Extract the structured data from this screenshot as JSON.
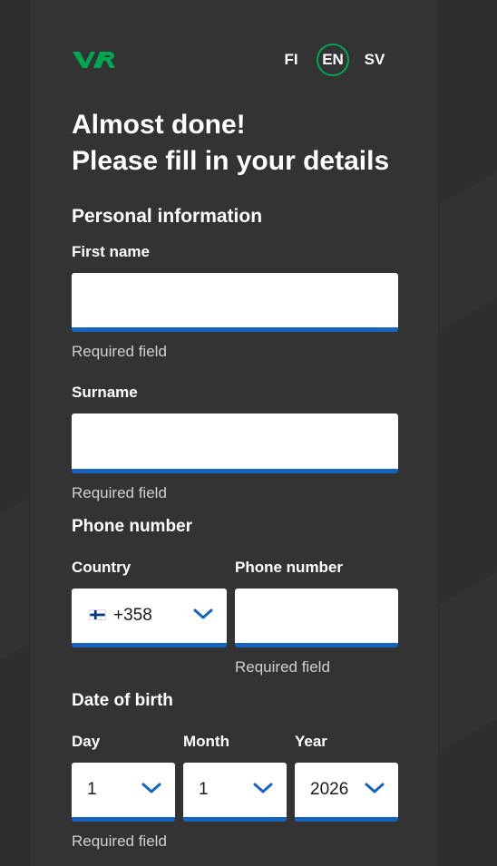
{
  "languages": {
    "fi": "FI",
    "en": "EN",
    "sv": "SV",
    "active": "EN"
  },
  "title": {
    "line1": "Almost done!",
    "line2": "Please fill in your details"
  },
  "personal": {
    "heading": "Personal information",
    "first_name_label": "First name",
    "first_name_value": "",
    "first_name_hint": "Required field",
    "surname_label": "Surname",
    "surname_value": "",
    "surname_hint": "Required field"
  },
  "phone": {
    "heading": "Phone number",
    "country_label": "Country",
    "country_value": "+358",
    "country_flag": "finland-flag-icon",
    "number_label": "Phone number",
    "number_value": "",
    "number_hint": "Required field"
  },
  "dob": {
    "heading": "Date of birth",
    "day_label": "Day",
    "day_value": "1",
    "month_label": "Month",
    "month_value": "1",
    "year_label": "Year",
    "year_value": "2026",
    "hint": "Required field"
  },
  "colors": {
    "brand_green": "#00a651",
    "accent_blue": "#1565c0",
    "panel_bg": "#333333",
    "page_bg": "#2e2e2e"
  }
}
